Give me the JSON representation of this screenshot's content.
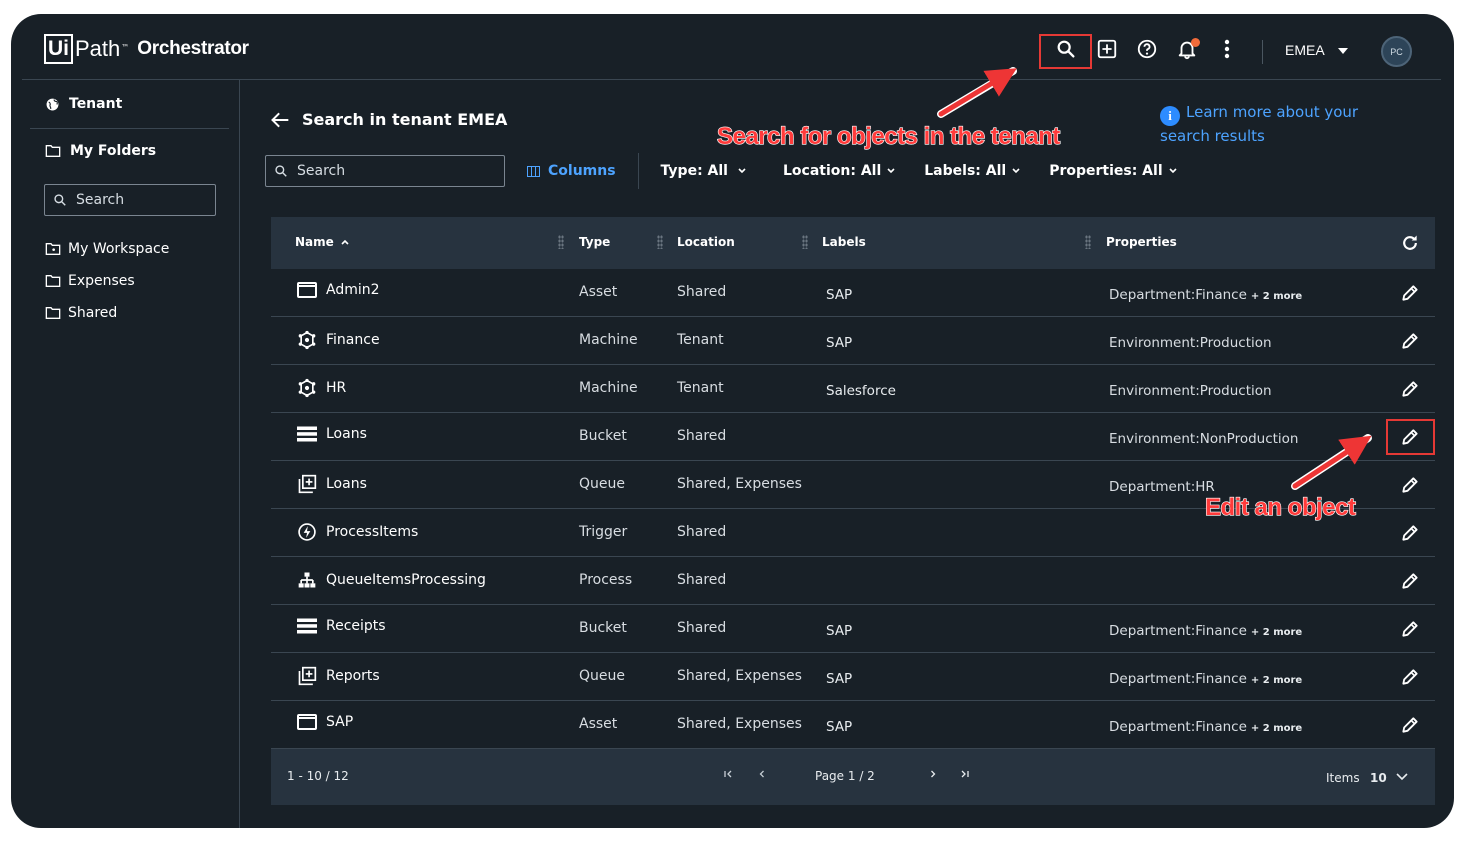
{
  "brand": {
    "box": "Ui",
    "path": "Path",
    "tm": "™",
    "product": "Orchestrator"
  },
  "header": {
    "tenant": "EMEA",
    "avatar": "PC"
  },
  "sidebar": {
    "tenant": "Tenant",
    "my_folders": "My Folders",
    "search_placeholder": "Search",
    "folders": [
      "My Workspace",
      "Expenses",
      "Shared"
    ]
  },
  "main": {
    "title": "Search in tenant EMEA",
    "learn_more": "Learn more about your search results",
    "search_placeholder": "Search",
    "columns_label": "Columns",
    "filters": {
      "type": "Type: All",
      "location": "Location: All",
      "labels": "Labels: All",
      "properties": "Properties: All"
    }
  },
  "annotations": {
    "search": "Search for objects in the tenant",
    "edit": "Edit an object"
  },
  "table": {
    "headers": {
      "name": "Name",
      "type": "Type",
      "location": "Location",
      "labels": "Labels",
      "properties": "Properties"
    },
    "rows": [
      {
        "icon": "asset-icon",
        "name": "Admin2",
        "type": "Asset",
        "location": "Shared",
        "labels": "SAP",
        "properties": "Department:Finance",
        "more": "+ 2 more"
      },
      {
        "icon": "machine-icon",
        "name": "Finance",
        "type": "Machine",
        "location": "Tenant",
        "labels": "SAP",
        "properties": "Environment:Production",
        "more": ""
      },
      {
        "icon": "machine-icon",
        "name": "HR",
        "type": "Machine",
        "location": "Tenant",
        "labels": "Salesforce",
        "properties": "Environment:Production",
        "more": ""
      },
      {
        "icon": "bucket-icon",
        "name": "Loans",
        "type": "Bucket",
        "location": "Shared",
        "labels": "",
        "properties": "Environment:NonProduction",
        "more": ""
      },
      {
        "icon": "queue-icon",
        "name": "Loans",
        "type": "Queue",
        "location": "Shared, Expenses",
        "labels": "",
        "properties": "Department:HR",
        "more": ""
      },
      {
        "icon": "trigger-icon",
        "name": "ProcessItems",
        "type": "Trigger",
        "location": "Shared",
        "labels": "",
        "properties": "",
        "more": ""
      },
      {
        "icon": "process-icon",
        "name": "QueueItemsProcessing",
        "type": "Process",
        "location": "Shared",
        "labels": "",
        "properties": "",
        "more": ""
      },
      {
        "icon": "bucket-icon",
        "name": "Receipts",
        "type": "Bucket",
        "location": "Shared",
        "labels": "SAP",
        "properties": "Department:Finance",
        "more": "+ 2 more"
      },
      {
        "icon": "queue-icon",
        "name": "Reports",
        "type": "Queue",
        "location": "Shared, Expenses",
        "labels": "SAP",
        "properties": "Department:Finance",
        "more": "+ 2 more"
      },
      {
        "icon": "asset-icon",
        "name": "SAP",
        "type": "Asset",
        "location": "Shared, Expenses",
        "labels": "SAP",
        "properties": "Department:Finance",
        "more": "+ 2 more"
      }
    ],
    "footer": {
      "range": "1 - 10 / 12",
      "page": "Page 1 / 2",
      "items_label": "Items",
      "items_value": "10"
    }
  },
  "colors": {
    "background": "#182027",
    "header_row": "#27333f",
    "accent": "#4da3ff",
    "highlight": "#e53935"
  }
}
